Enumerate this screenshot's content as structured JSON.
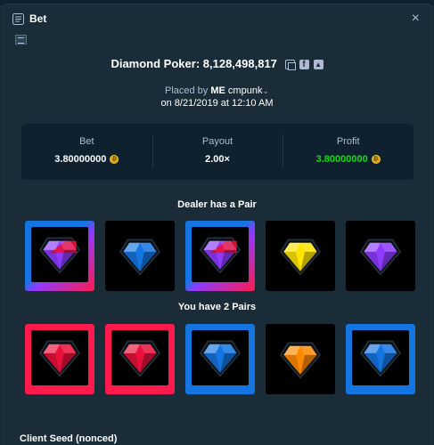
{
  "modal": {
    "title": "Bet",
    "close_label": "×"
  },
  "game": {
    "name": "Diamond Poker",
    "bet_id": "8,128,498,817",
    "title_sep": ": "
  },
  "share_icons": [
    "copy-icon",
    "facebook-icon",
    "twitter-icon"
  ],
  "placed": {
    "prefix": "Placed by",
    "user_badge": "ME",
    "username": "cmpunk",
    "date": "on 8/21/2019 at 12:10 AM"
  },
  "stats": {
    "bet": {
      "label": "Bet",
      "value": "3.80000000",
      "currency_icon": "bitcoin-coin-icon"
    },
    "payout": {
      "label": "Payout",
      "value": "2.00×"
    },
    "profit": {
      "label": "Profit",
      "value": "3.80000000",
      "currency_icon": "bitcoin-coin-icon"
    }
  },
  "dealer": {
    "label": "Dealer has a Pair",
    "gems": [
      {
        "color": "purple",
        "highlight": "dealer-pair"
      },
      {
        "color": "blue",
        "highlight": "none"
      },
      {
        "color": "purple",
        "highlight": "dealer-pair"
      },
      {
        "color": "yellow",
        "highlight": "none"
      },
      {
        "color": "violet",
        "highlight": "none"
      }
    ]
  },
  "player": {
    "label": "You have 2 Pairs",
    "gems": [
      {
        "color": "red",
        "highlight": "pair-red"
      },
      {
        "color": "red",
        "highlight": "pair-red"
      },
      {
        "color": "blue",
        "highlight": "pair-blue"
      },
      {
        "color": "orange",
        "highlight": "none"
      },
      {
        "color": "blue",
        "highlight": "pair-blue"
      }
    ]
  },
  "seed": {
    "label": "Client Seed (nonced)"
  },
  "colors": {
    "background": "#1a2c38",
    "panel": "#0f212e",
    "profit": "#00e701",
    "gem_red": "#e9113c",
    "gem_blue": "#1475e1",
    "gem_yellow": "#ffe500",
    "gem_orange": "#ff8a00",
    "gem_violet": "#8d3bff",
    "border_red": "#ff1a4d",
    "border_blue": "#1475e1",
    "border_purple": "#8d3bff"
  }
}
